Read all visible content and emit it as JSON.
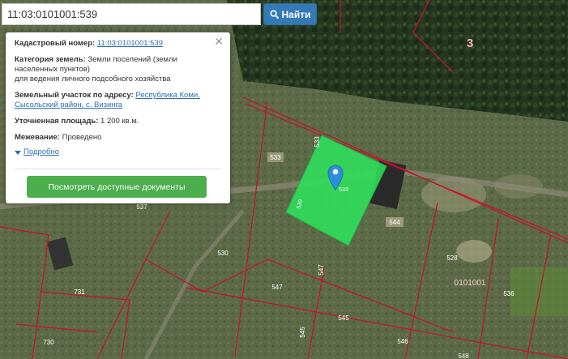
{
  "search": {
    "value": "11:03:0101001:539",
    "button_label": "Найти",
    "icon": "search-icon"
  },
  "popup": {
    "cadastral_label": "Кадастровый номер:",
    "cadastral_value": "11:03:0101001:539",
    "category_label": "Категория земель:",
    "category_value_1": "Земли поселений (земли",
    "category_value_2": "населенных пунктов)",
    "category_value_3": "для ведения личного подсобного хозяйства",
    "address_label": "Земельный участок по адресу:",
    "address_value_1": "Республика Коми,",
    "address_value_2": "Сысольский район, с. Визинга",
    "area_label": "Уточненная площадь:",
    "area_value": "1 200 кв.м.",
    "survey_label": "Межевание:",
    "survey_value": "Проведено",
    "more_label": "Подробно",
    "docs_button": "Посмотреть доступные документы"
  },
  "map_labels": {
    "zone": "3",
    "block": "0101001",
    "p533a": "533",
    "p533b": "533",
    "p537": "537",
    "p544": "544",
    "p530": "530",
    "p528": "528",
    "p547a": "547",
    "p547b": "547",
    "p536": "536",
    "p731": "731",
    "p545a": "545",
    "p545b": "545",
    "p546": "546",
    "p730": "730",
    "p548": "548",
    "p539a": "539",
    "p539b": "539"
  },
  "colors": {
    "parcel_fill": "#2ee05a",
    "boundary": "#c8102e",
    "button_blue": "#337ab7",
    "button_green": "#4cae4c"
  }
}
